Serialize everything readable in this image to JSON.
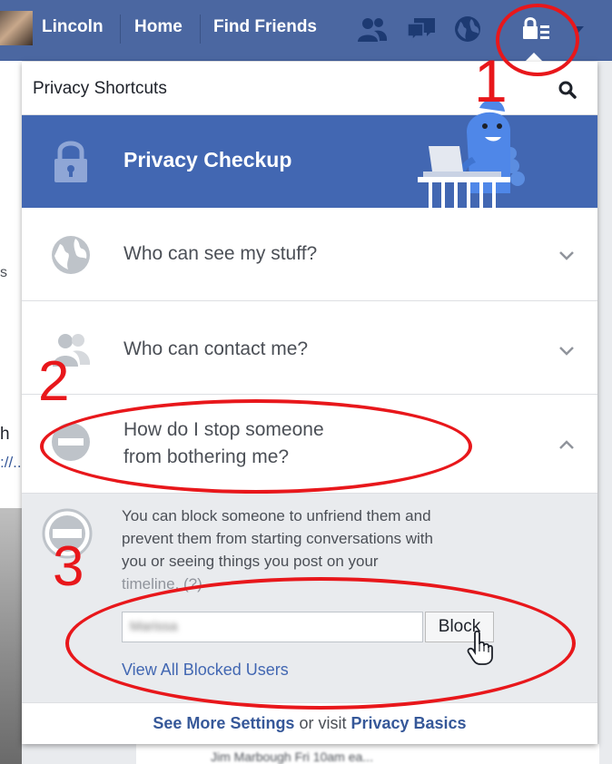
{
  "topbar": {
    "user_name": "Lincoln",
    "home_label": "Home",
    "find_friends_label": "Find Friends"
  },
  "panel": {
    "title": "Privacy Shortcuts",
    "checkup_title": "Privacy Checkup",
    "rows": [
      {
        "label": "Who can see my stuff?",
        "icon": "globe-icon"
      },
      {
        "label": "Who can contact me?",
        "icon": "people-icon"
      },
      {
        "label_line1": "How do I stop someone",
        "label_line2": "from bothering me?",
        "icon": "block-icon"
      }
    ],
    "expanded": {
      "desc_line1": "You can block someone to unfriend them and",
      "desc_line2": "prevent them from starting conversations with",
      "desc_line3": "you or seeing things you post on your",
      "desc_line4": "timeline. (?)",
      "input_value": "Marissa",
      "block_label": "Block",
      "view_blocked_label": "View All Blocked Users"
    },
    "footer": {
      "see_more": "See More Settings",
      "or_visit": " or visit ",
      "privacy_basics": "Privacy Basics"
    }
  },
  "annotations": {
    "step1": "1",
    "step2": "2",
    "step3": "3"
  },
  "background": {
    "left_fragment_1": "s",
    "left_fragment_2": "h",
    "left_fragment_3": "://..",
    "bottom_fragment": "Jim Marbough  Fri 10am ea..."
  },
  "colors": {
    "facebook_blue": "#4267b2",
    "topbar": "#4b67a1",
    "annotation_red": "#e8171b"
  }
}
